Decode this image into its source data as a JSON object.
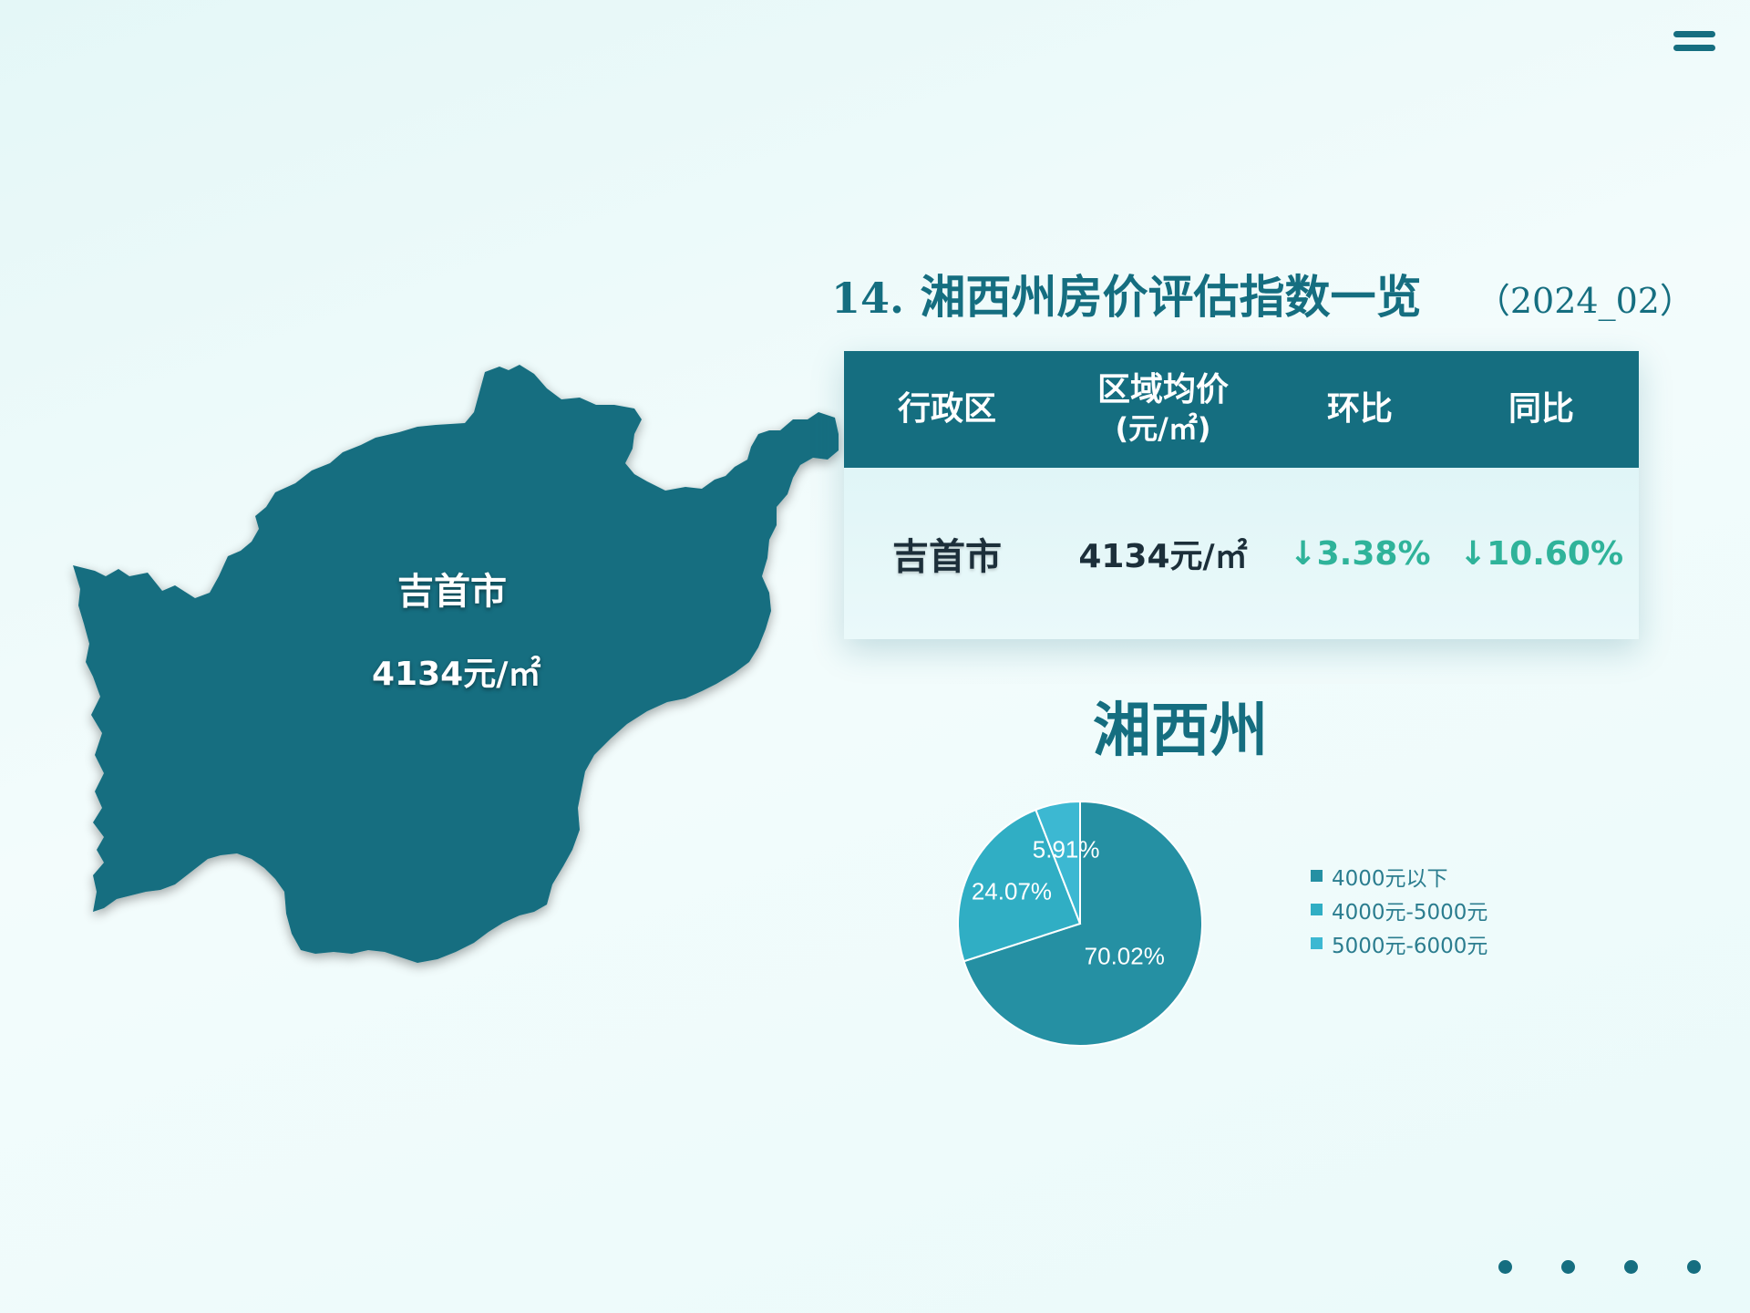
{
  "page_title": {
    "number": "14.",
    "text": "湘西州房价评估指数一览",
    "date": "（2024_02）"
  },
  "map": {
    "region_name": "吉首市",
    "region_price": "4134元/㎡",
    "fill_color": "#156e80"
  },
  "table": {
    "headers": [
      "行政区",
      "区域均价",
      "(元/㎡)",
      "环比",
      "同比"
    ],
    "row": {
      "district": "吉首市",
      "price": "4134元/㎡",
      "mom": "↓3.38%",
      "yoy": "↓10.60%"
    },
    "header_color": "#156e80",
    "change_color": "#2fb39a"
  },
  "region_title": "湘西州",
  "chart_data": {
    "type": "pie",
    "title": "",
    "categories": [
      "4000元以下",
      "4000元-5000元",
      "5000元-6000元"
    ],
    "values": [
      70.02,
      24.07,
      5.91
    ],
    "labels": [
      "70.02%",
      "24.07%",
      "5.91%"
    ],
    "colors": [
      "#2590a3",
      "#30aec4",
      "#3cb8d2"
    ],
    "legend_position": "right"
  }
}
